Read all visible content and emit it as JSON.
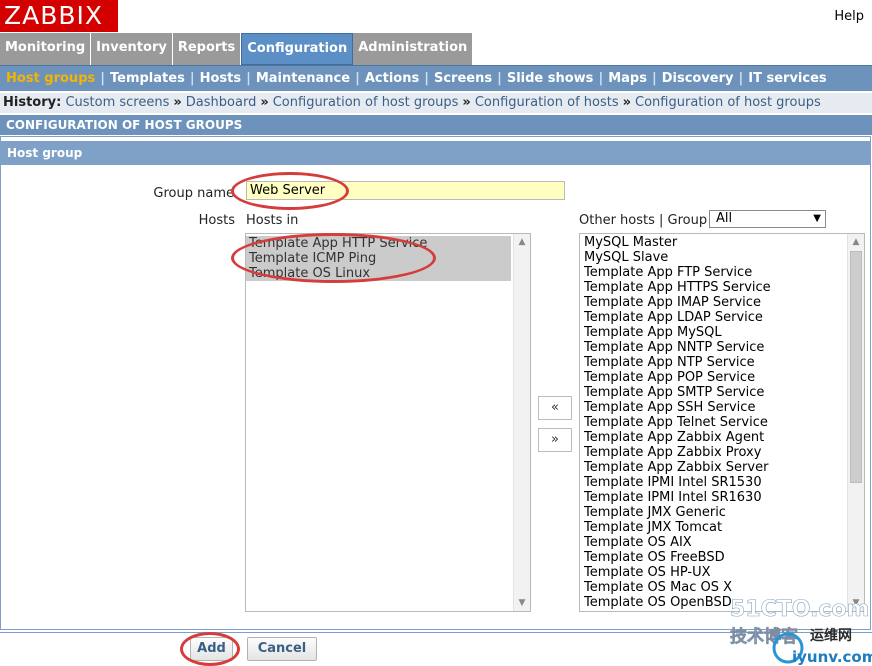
{
  "app": {
    "logo": "ZABBIX",
    "help": "Help"
  },
  "main_menu": [
    {
      "label": "Monitoring"
    },
    {
      "label": "Inventory"
    },
    {
      "label": "Reports"
    },
    {
      "label": "Configuration",
      "active": true
    },
    {
      "label": "Administration"
    }
  ],
  "sub_menu": [
    {
      "label": "Host groups",
      "active": true
    },
    {
      "label": "Templates"
    },
    {
      "label": "Hosts"
    },
    {
      "label": "Maintenance"
    },
    {
      "label": "Actions"
    },
    {
      "label": "Screens"
    },
    {
      "label": "Slide shows"
    },
    {
      "label": "Maps"
    },
    {
      "label": "Discovery"
    },
    {
      "label": "IT services"
    }
  ],
  "history": {
    "label": "History:",
    "items": [
      "Custom screens",
      "Dashboard",
      "Configuration of host groups",
      "Configuration of hosts",
      "Configuration of host groups"
    ]
  },
  "section_title": "CONFIGURATION OF HOST GROUPS",
  "form": {
    "header": "Host group",
    "group_name_label": "Group name",
    "group_name_value": "Web Server",
    "hosts_label": "Hosts",
    "hosts_in_label": "Hosts in",
    "hosts_in": [
      "Template App HTTP Service",
      "Template ICMP Ping",
      "Template OS Linux"
    ],
    "other_hosts_label": "Other hosts | Group",
    "group_filter_value": "All",
    "other_hosts": [
      "MySQL Master",
      "MySQL Slave",
      "Template App FTP Service",
      "Template App HTTPS Service",
      "Template App IMAP Service",
      "Template App LDAP Service",
      "Template App MySQL",
      "Template App NNTP Service",
      "Template App NTP Service",
      "Template App POP Service",
      "Template App SMTP Service",
      "Template App SSH Service",
      "Template App Telnet Service",
      "Template App Zabbix Agent",
      "Template App Zabbix Proxy",
      "Template App Zabbix Server",
      "Template IPMI Intel SR1530",
      "Template IPMI Intel SR1630",
      "Template JMX Generic",
      "Template JMX Tomcat",
      "Template OS AIX",
      "Template OS FreeBSD",
      "Template OS HP-UX",
      "Template OS Mac OS X",
      "Template OS OpenBSD"
    ],
    "move_left": "«",
    "move_right": "»",
    "add_label": "Add",
    "cancel_label": "Cancel"
  },
  "watermark": {
    "site": "51CTO.com",
    "tagline": "技术博客",
    "brand": "运维网",
    "url": "iyunv.com"
  },
  "colors": {
    "logo_bg": "#d40000",
    "menu_active": "#5b8fc6",
    "submenu_bg": "#6d93bd",
    "submenu_active": "#f4b400",
    "annotation": "#d63c3c",
    "input_bg": "#ffffc2"
  }
}
